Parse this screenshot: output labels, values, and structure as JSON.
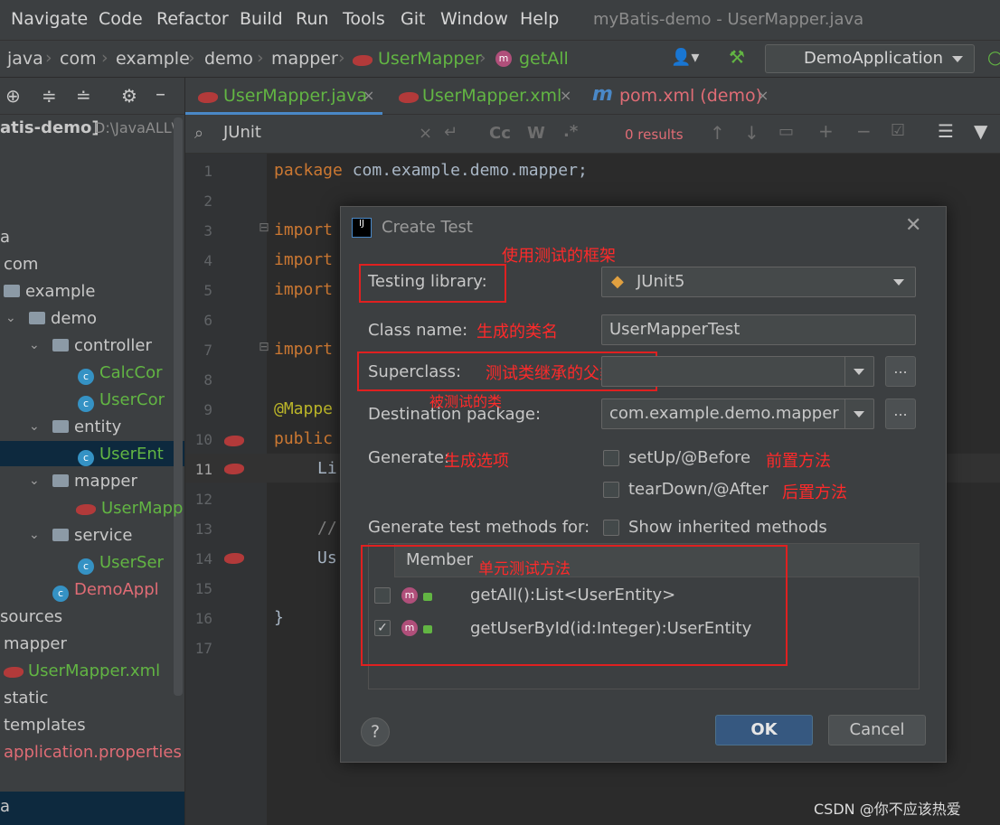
{
  "menu": {
    "items": [
      "Navigate",
      "Code",
      "Refactor",
      "Build",
      "Run",
      "Tools",
      "Git",
      "Window",
      "Help"
    ],
    "window_title": "myBatis-demo - UserMapper.java"
  },
  "breadcrumb": {
    "items": [
      "java",
      "com",
      "example",
      "demo",
      "mapper",
      "UserMapper",
      "getAll"
    ],
    "run_config": "DemoApplication"
  },
  "project": {
    "root_label": "atis-demo]",
    "root_path": "D:\\JavaALL\\",
    "tree": [
      "a",
      "com",
      "example",
      "demo",
      "controller",
      "CalcCor",
      "UserCor",
      "entity",
      "UserEnt",
      "mapper",
      "UserMapp",
      "service",
      "UserSer",
      "DemoAppl",
      "sources",
      "mapper",
      "UserMapper.xml",
      "static",
      "templates",
      "application.properties",
      "a"
    ]
  },
  "tabs": [
    "UserMapper.java",
    "UserMapper.xml",
    "pom.xml (demo)"
  ],
  "search": {
    "query": "JUnit",
    "results": "0 results",
    "cc": "Cc",
    "w": "W",
    "regex": ".*"
  },
  "editor": {
    "line_numbers": [
      "1",
      "2",
      "3",
      "4",
      "5",
      "6",
      "7",
      "8",
      "9",
      "10",
      "11",
      "12",
      "13",
      "14",
      "15",
      "16",
      "17"
    ],
    "lines": {
      "l1_kw": "package",
      "l1_rest": " com.example.demo.mapper;",
      "l3": "import",
      "l4": "import",
      "l5": "import",
      "l7": "import",
      "l9": "@Mappe",
      "l10": "public",
      "l11": "Li",
      "l13": "//",
      "l14": "Us",
      "l16": "}"
    }
  },
  "dialog": {
    "title": "Create Test",
    "testing_library_label": "Testing library:",
    "testing_library_value": "JUnit5",
    "class_name_label": "Class name:",
    "class_name_value": "UserMapperTest",
    "superclass_label": "Superclass:",
    "superclass_value": "",
    "destination_label": "Destination package:",
    "destination_value": "com.example.demo.mapper",
    "generate_label": "Generate:",
    "setup_label": "setUp/@Before",
    "teardown_label": "tearDown/@After",
    "generate_methods_label": "Generate test methods for:",
    "show_inherited_label": "Show inherited methods",
    "member_header": "Member",
    "members": [
      {
        "signature": "getAll():List<UserEntity>",
        "checked": false
      },
      {
        "signature": "getUserById(id:Integer):UserEntity",
        "checked": true
      }
    ],
    "ok_label": "OK",
    "cancel_label": "Cancel",
    "browse": "...",
    "help": "?",
    "check_mark": "✓"
  },
  "annotations": {
    "framework": "使用测试的框架",
    "class_name": "生成的类名",
    "superclass": "测试类继承的父类",
    "tested_class": "被测试的类",
    "generate": "生成选项",
    "before": "前置方法",
    "after": "后置方法",
    "unit_methods": "单元测试方法"
  },
  "watermark": "CSDN @你不应该热爱",
  "colors": {
    "accent": "#4a88c7",
    "annotation_red": "#ff2a2a",
    "green": "#62b543"
  }
}
